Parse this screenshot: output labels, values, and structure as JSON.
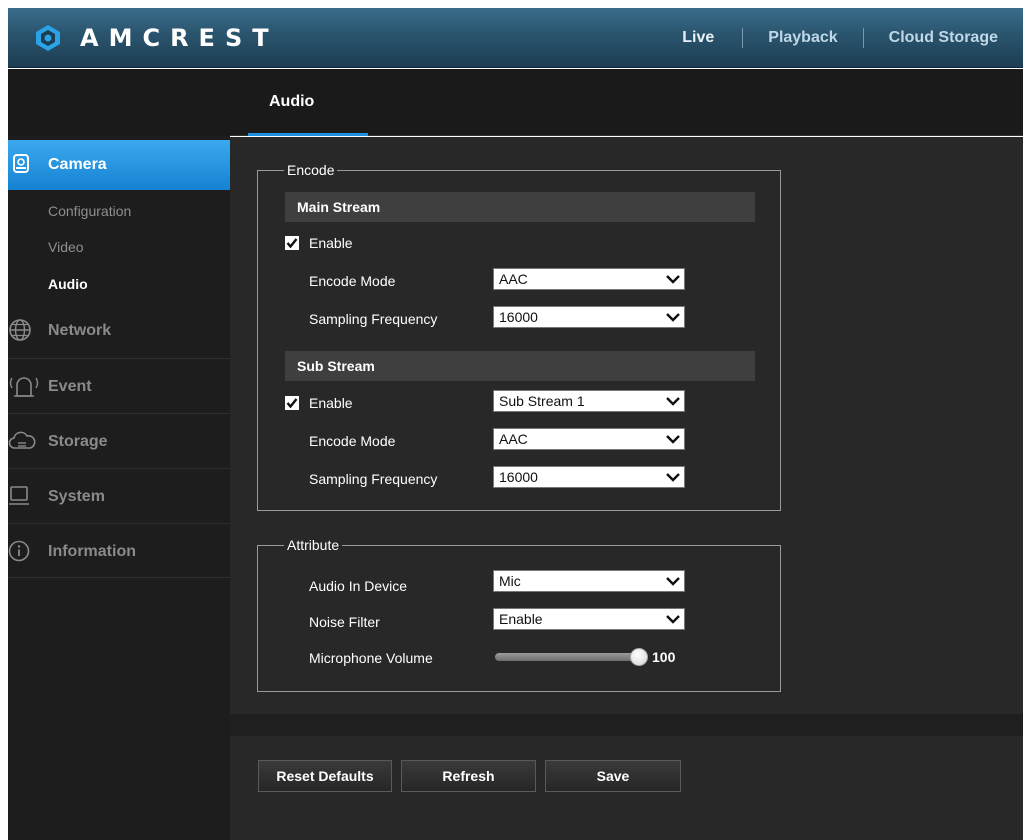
{
  "brand": {
    "name": "AMCREST"
  },
  "topnav": {
    "live": "Live",
    "playback": "Playback",
    "cloud": "Cloud Storage"
  },
  "sidebar": {
    "camera": {
      "label": "Camera",
      "icon": "camera-icon",
      "sub": [
        "Configuration",
        "Video",
        "Audio"
      ],
      "active_sub": "Audio"
    },
    "items": [
      {
        "label": "Network",
        "icon": "globe-icon"
      },
      {
        "label": "Event",
        "icon": "alarm-icon"
      },
      {
        "label": "Storage",
        "icon": "cloud-icon"
      },
      {
        "label": "System",
        "icon": "monitor-icon"
      },
      {
        "label": "Information",
        "icon": "info-icon"
      }
    ]
  },
  "tab": {
    "label": "Audio"
  },
  "encode": {
    "legend": "Encode",
    "main": {
      "title": "Main Stream",
      "enable_label": "Enable",
      "enabled": true,
      "encode_mode_label": "Encode Mode",
      "encode_mode": "AAC",
      "sampling_label": "Sampling Frequency",
      "sampling": "16000"
    },
    "sub": {
      "title": "Sub Stream",
      "enable_label": "Enable",
      "enabled": true,
      "stream": "Sub Stream 1",
      "encode_mode_label": "Encode Mode",
      "encode_mode": "AAC",
      "sampling_label": "Sampling Frequency",
      "sampling": "16000"
    }
  },
  "attribute": {
    "legend": "Attribute",
    "audio_in_label": "Audio In Device",
    "audio_in": "Mic",
    "noise_label": "Noise Filter",
    "noise": "Enable",
    "volume_label": "Microphone Volume",
    "volume": "100",
    "volume_fraction": 1.0
  },
  "buttons": {
    "reset": "Reset Defaults",
    "refresh": "Refresh",
    "save": "Save"
  },
  "colors": {
    "accent": "#1e8fe0",
    "header": "#2b5670",
    "sidebar": "#1d1d1d",
    "content": "#282828"
  }
}
